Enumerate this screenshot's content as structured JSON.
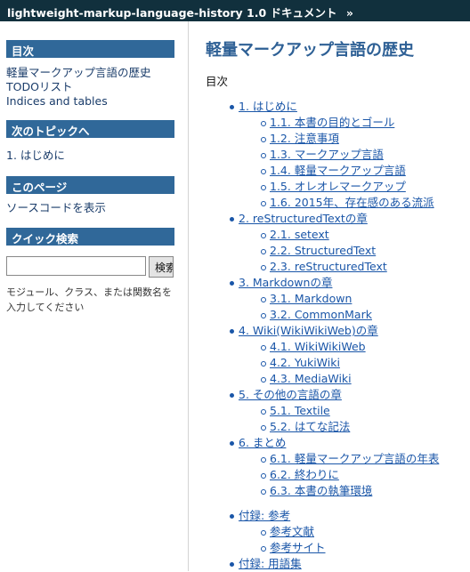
{
  "topbar": {
    "project": "lightweight-markup-language-history 1.0 ドキュメント",
    "separator": "»"
  },
  "sidebar": {
    "toc_heading": "目次",
    "toc_links": [
      "軽量マークアップ言語の歴史",
      "TODOリスト",
      "Indices and tables"
    ],
    "next_heading": "次のトピックへ",
    "next_link": "1. はじめに",
    "page_heading": "このページ",
    "page_link": "ソースコードを表示",
    "search_heading": "クイック検索",
    "search_button": "検索",
    "search_help": "モジュール、クラス、または関数名を入力してください"
  },
  "main": {
    "title": "軽量マークアップ言語の歴史",
    "toc_label": "目次",
    "toc": [
      {
        "label": "1. はじめに",
        "children": [
          "1.1. 本書の目的とゴール",
          "1.2. 注意事項",
          "1.3. マークアップ言語",
          "1.4. 軽量マークアップ言語",
          "1.5. オレオレマークアップ",
          "1.6. 2015年、存在感のある流派"
        ]
      },
      {
        "label": "2. reStructuredTextの章",
        "children": [
          "2.1. setext",
          "2.2. StructuredText",
          "2.3. reStructuredText"
        ]
      },
      {
        "label": "3. Markdownの章",
        "children": [
          "3.1. Markdown",
          "3.2. CommonMark"
        ]
      },
      {
        "label": "4. Wiki(WikiWikiWeb)の章",
        "children": [
          "4.1. WikiWikiWeb",
          "4.2. YukiWiki",
          "4.3. MediaWiki"
        ]
      },
      {
        "label": "5. その他の言語の章",
        "children": [
          "5.1. Textile",
          "5.2. はてな記法"
        ]
      },
      {
        "label": "6. まとめ",
        "children": [
          "6.1. 軽量マークアップ言語の年表",
          "6.2. 終わりに",
          "6.3. 本書の執筆環境"
        ]
      }
    ],
    "appendix": [
      {
        "label": "付録: 参考",
        "children": [
          "参考文献",
          "参考サイト"
        ]
      },
      {
        "label": "付録: 用語集",
        "children": []
      }
    ]
  },
  "colors": {
    "topbar_bg": "#11303d",
    "sidebar_heading_bg": "#306899",
    "title": "#2e6095",
    "link": "#1a56a8"
  }
}
